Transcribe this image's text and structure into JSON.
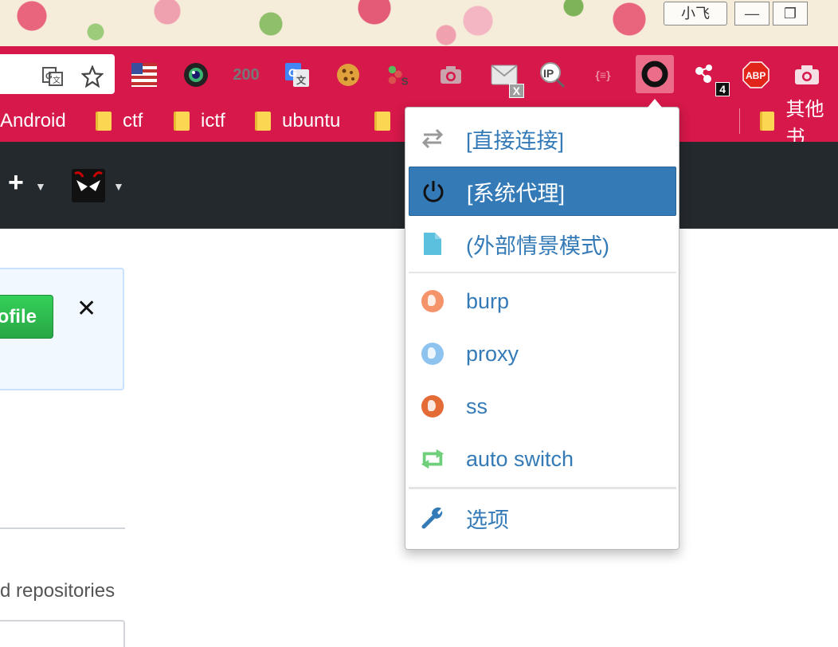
{
  "window": {
    "user_label": "小飞",
    "minimize_glyph": "—",
    "restore_glyph": "❐"
  },
  "toolbar": {
    "translate_icon": "translate-icon",
    "bookmark_star_icon": "star-icon",
    "extensions": [
      {
        "name": "flag-icon",
        "glyph": "🇺🇸"
      },
      {
        "name": "camera-lens-icon",
        "glyph": "◉"
      },
      {
        "name": "status-200-icon",
        "glyph": "200"
      },
      {
        "name": "google-translate-icon",
        "glyph": "G"
      },
      {
        "name": "cookie-icon",
        "glyph": "🍪"
      },
      {
        "name": "proxy-s-icon",
        "glyph": "S"
      },
      {
        "name": "screenshot-camera-icon",
        "glyph": "📷"
      },
      {
        "name": "mail-x-icon",
        "glyph": "✉"
      },
      {
        "name": "ip-lookup-icon",
        "glyph": "IP"
      },
      {
        "name": "json-viewer-icon",
        "glyph": "{≡}"
      },
      {
        "name": "switchyomega-icon",
        "glyph": ""
      },
      {
        "name": "share-badge-icon",
        "glyph": "⁂"
      },
      {
        "name": "adblock-plus-icon",
        "glyph": "ABP"
      },
      {
        "name": "capture-camera-icon",
        "glyph": "📷"
      }
    ],
    "mail_badge": "X",
    "share_badge": "4",
    "colors": {
      "accent": "#d6184a",
      "active_ext_bg": "#ec6d8a"
    }
  },
  "bookmarks": {
    "items": [
      "Android",
      "ctf",
      "ictf",
      "ubuntu",
      ""
    ],
    "other_label": "其他书"
  },
  "github": {
    "plus_glyph": "+",
    "notice_button": "ofile",
    "close_glyph": "✕",
    "repos_text": "d repositories"
  },
  "proxy_menu": {
    "items": [
      {
        "label": "[直接连接]",
        "icon": "direct-connect-icon"
      },
      {
        "label": "[系统代理]",
        "icon": "power-icon",
        "active": true
      },
      {
        "label": "(外部情景模式)",
        "icon": "file-icon"
      },
      {
        "label": "burp",
        "icon": "globe-icon",
        "color": "#f5936b"
      },
      {
        "label": "proxy",
        "icon": "globe-icon",
        "color": "#8ec3ef"
      },
      {
        "label": "ss",
        "icon": "globe-icon",
        "color": "#e46a36"
      },
      {
        "label": "auto switch",
        "icon": "auto-switch-icon",
        "color": "#6fcf7a"
      },
      {
        "label": "选项",
        "icon": "wrench-icon"
      }
    ],
    "colors": {
      "link": "#337ab7",
      "active_bg": "#337ab7"
    }
  }
}
